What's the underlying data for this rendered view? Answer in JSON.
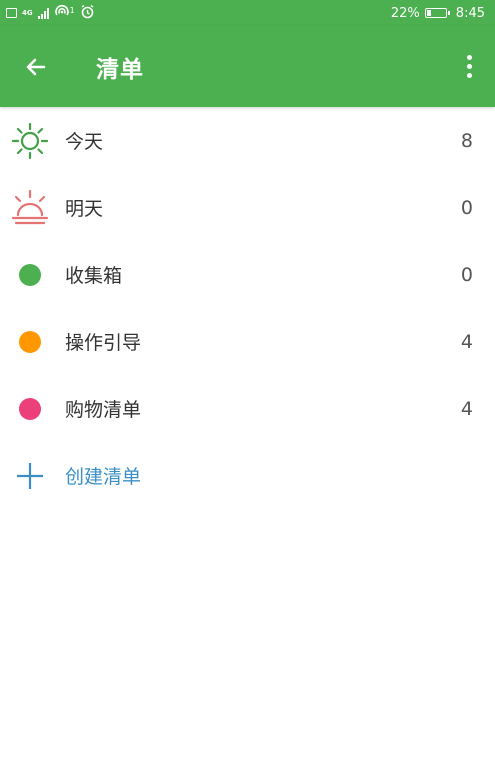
{
  "status_bar": {
    "network": "4G",
    "superscript": "1",
    "battery_percent": "22%",
    "battery_level": 0.22,
    "time": "8:45"
  },
  "app_bar": {
    "title": "清单"
  },
  "colors": {
    "primary": "#4caf50",
    "today_icon": "#43a047",
    "tomorrow_icon": "#e57373",
    "inbox_dot": "#4caf50",
    "guide_dot": "#ff9800",
    "shopping_dot": "#ec407a",
    "create_accent": "#3a8fc7"
  },
  "lists": [
    {
      "label": "今天",
      "count": "8",
      "icon": "sun-icon"
    },
    {
      "label": "明天",
      "count": "0",
      "icon": "sunrise-icon"
    },
    {
      "label": "收集箱",
      "count": "0",
      "icon": "green-dot"
    },
    {
      "label": "操作引导",
      "count": "4",
      "icon": "orange-dot"
    },
    {
      "label": "购物清单",
      "count": "4",
      "icon": "pink-dot"
    }
  ],
  "create": {
    "label": "创建清单",
    "icon": "plus-icon"
  }
}
